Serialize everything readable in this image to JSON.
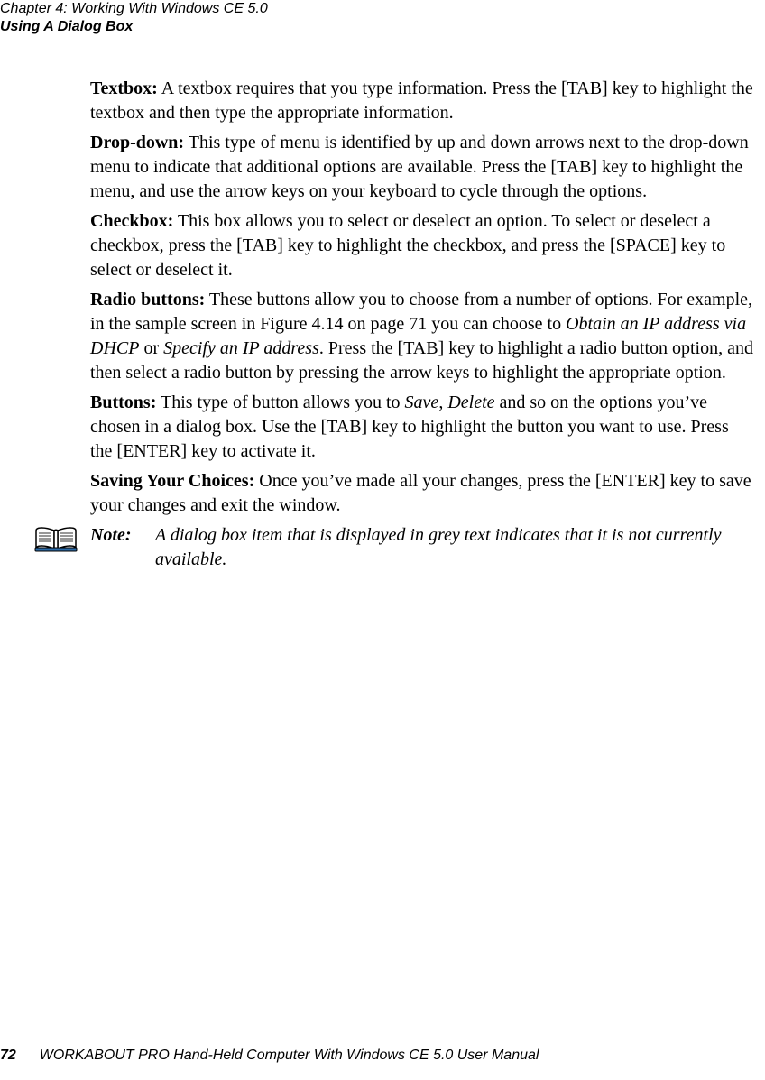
{
  "header": {
    "chapter": "Chapter 4: Working With Windows CE 5.0",
    "section": "Using A Dialog Box"
  },
  "body": {
    "p1": {
      "term": "Textbox:",
      "text": " A textbox requires that you type information. Press the [TAB] key to highlight the textbox and then type the appropriate information."
    },
    "p2": {
      "term": "Drop-down:",
      "text": " This type of menu is identified by up and down arrows next to the drop-down menu to indicate that additional options are available. Press the [TAB] key to highlight the menu, and use the arrow keys on your keyboard to cycle through the options."
    },
    "p3": {
      "term": "Checkbox:",
      "text": " This box allows you to select or deselect an option. To select or deselect a checkbox, press the [TAB] key to highlight the checkbox, and press the [SPACE] key to select or deselect it."
    },
    "p4": {
      "term": "Radio buttons:",
      "a": " These buttons allow you to choose from a number of options. For example, in the sample screen in Figure 4.14 on page 71 you can choose to ",
      "i1": "Obtain an IP address via DHCP",
      "b": " or ",
      "i2": "Specify an IP address",
      "c": ". Press the [TAB] key to highlight a radio button option, and then select a radio button by pressing the arrow keys to highlight the appropriate option."
    },
    "p5": {
      "term": "Buttons:",
      "a": " This type of button allows you to ",
      "i1": "Save",
      "b": ", ",
      "i2": "Delete",
      "c": " and so on the options you’ve chosen in a dialog box. Use the [TAB] key to highlight the button you want to use. Press the [ENTER] key to activate it."
    },
    "p6": {
      "term": "Saving Your Choices:",
      "text": " Once you’ve made all your changes, press the [ENTER] key to save your changes and exit the window."
    },
    "note": {
      "label": "Note:",
      "text": "A dialog box item that is displayed in grey text indicates that it is not currently available."
    }
  },
  "footer": {
    "page": "72",
    "title": "WORKABOUT PRO Hand-Held Computer With Windows CE 5.0 User Manual"
  }
}
